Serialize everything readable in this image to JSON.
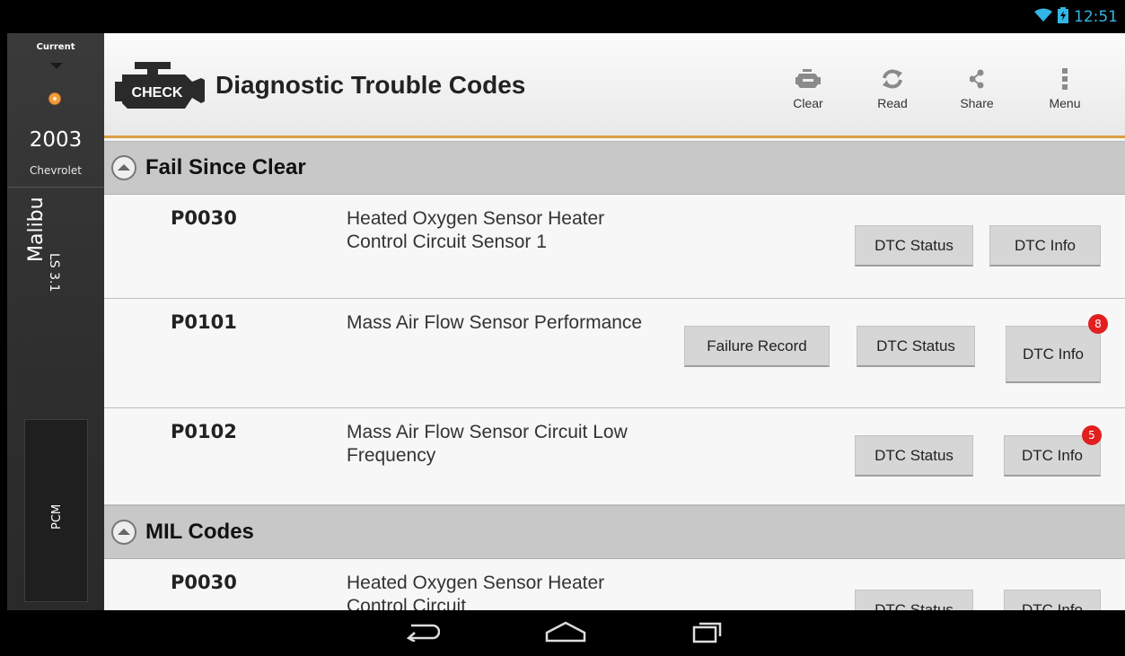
{
  "status_bar": {
    "time": "12:51",
    "icons": [
      "wifi-icon",
      "battery-charging-icon"
    ]
  },
  "side_panel": {
    "current_label": "Current",
    "year": "2003",
    "make": "Chevrolet",
    "model": "Malibu",
    "trim": "LS 3.1",
    "module": "PCM"
  },
  "header": {
    "logo_text": "CHECK",
    "title": "Diagnostic Trouble Codes",
    "actions": [
      {
        "label": "Clear",
        "icon": "engine-clear-icon"
      },
      {
        "label": "Read",
        "icon": "refresh-icon"
      },
      {
        "label": "Share",
        "icon": "share-icon"
      },
      {
        "label": "Menu",
        "icon": "overflow-menu-icon"
      }
    ]
  },
  "sections": [
    {
      "title": "Fail Since Clear",
      "rows": [
        {
          "code": "P0030",
          "description": "Heated Oxygen Sensor Heater Control Circuit Sensor 1",
          "buttons": {
            "status": "DTC Status",
            "info": "DTC Info"
          }
        },
        {
          "code": "P0101",
          "description": "Mass Air Flow Sensor Performance",
          "buttons": {
            "failure": "Failure Record",
            "status": "DTC Status",
            "info": "DTC Info"
          },
          "info_badge": "8"
        },
        {
          "code": "P0102",
          "description": "Mass Air Flow Sensor Circuit Low Frequency",
          "buttons": {
            "status": "DTC Status",
            "info": "DTC Info"
          },
          "info_badge": "5"
        }
      ]
    },
    {
      "title": "MIL Codes",
      "rows": [
        {
          "code": "P0030",
          "description": "Heated Oxygen Sensor Heater Control Circuit",
          "buttons": {
            "status": "DTC Status",
            "info": "DTC Info"
          }
        }
      ]
    }
  ],
  "nav_bar": {
    "buttons": [
      "back-icon",
      "home-icon",
      "recent-apps-icon"
    ]
  },
  "colors": {
    "accent_line": "#d9a042",
    "badge": "#e21f1f",
    "status_time": "#33b5e5"
  }
}
